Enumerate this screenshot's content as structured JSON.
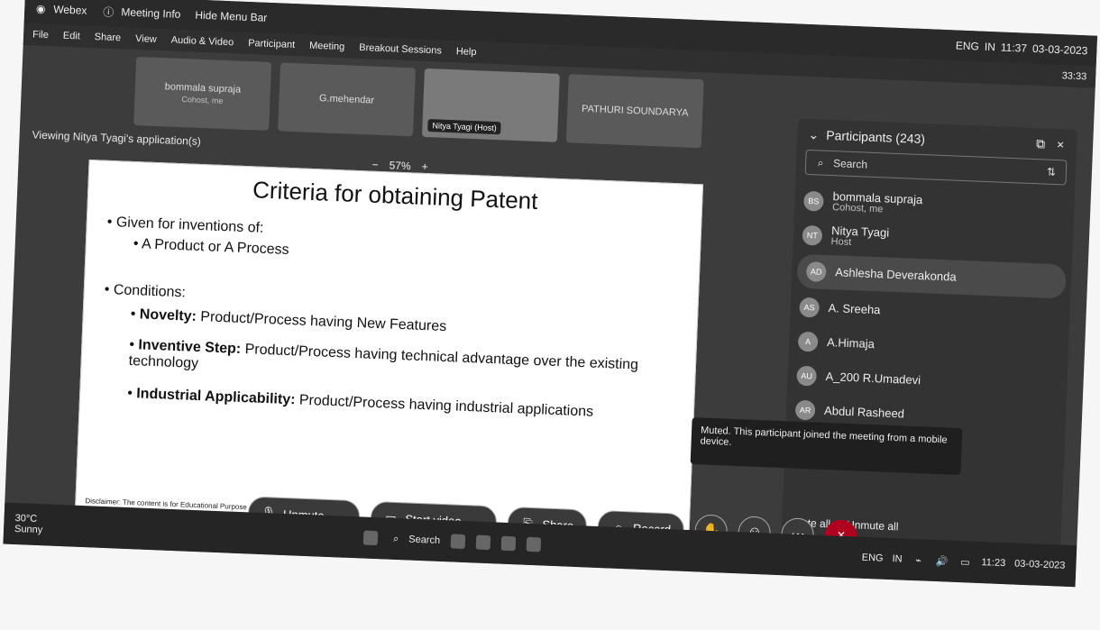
{
  "app": {
    "top_items": [
      "Webex",
      "Meeting Info",
      "Hide Menu Bar"
    ],
    "menu": [
      "File",
      "Edit",
      "Share",
      "View",
      "Audio & Video",
      "Participant",
      "Meeting",
      "Breakout Sessions",
      "Help"
    ],
    "clock_top": "11:37",
    "date_top": "03-03-2023",
    "lang_top": [
      "ENG",
      "IN"
    ],
    "timer": "33:33"
  },
  "thumbnails": [
    {
      "name": "bommala supraja",
      "sub": "Cohost, me"
    },
    {
      "name": "G.mehendar",
      "sub": ""
    },
    {
      "name": "Nitya Tyagi (Host)",
      "sub": ""
    },
    {
      "name": "PATHURI SOUNDARYA",
      "sub": ""
    }
  ],
  "viewing": "Viewing Nitya Tyagi's application(s)",
  "zoom": {
    "minus": "−",
    "value": "57%",
    "plus": "+"
  },
  "slide": {
    "title": "Criteria for obtaining Patent",
    "l1": "Given for inventions of:",
    "l2": "A Product or A Process",
    "l3": "Conditions:",
    "n_label": "Novelty:",
    "n_text": "Product/Process having New Features",
    "i_label": "Inventive Step:",
    "i_text": "Product/Process having technical advantage over the existing technology",
    "a_label": "Industrial Applicability:",
    "a_text": "Product/Process having industrial applications",
    "disclaimer": "Disclaimer: The content is for Educational Purpose only"
  },
  "participants": {
    "title": "Participants (243)",
    "search_placeholder": "Search",
    "items": [
      {
        "initials": "BS",
        "name": "bommala supraja",
        "sub": "Cohost, me"
      },
      {
        "initials": "NT",
        "name": "Nitya Tyagi",
        "sub": "Host"
      },
      {
        "initials": "AD",
        "name": "Ashlesha Deverakonda",
        "sub": ""
      },
      {
        "initials": "AS",
        "name": "A. Sreeha",
        "sub": ""
      },
      {
        "initials": "A",
        "name": "A.Himaja",
        "sub": ""
      },
      {
        "initials": "AU",
        "name": "A_200 R.Umadevi",
        "sub": ""
      },
      {
        "initials": "AR",
        "name": "Abdul Rasheed",
        "sub": ""
      }
    ],
    "mute_all": "Mute all",
    "unmute_all": "Unmute all"
  },
  "tooltip": "Muted. This participant joined the meeting from a mobile device.",
  "controls": {
    "unmute": "Unmute",
    "start_video": "Start video",
    "share": "Share",
    "record": "Record"
  },
  "taskbar": {
    "temp": "30°C",
    "weather": "Sunny",
    "search": "Search",
    "lang": [
      "ENG",
      "IN"
    ],
    "time": "11:23",
    "date": "03-03-2023"
  }
}
